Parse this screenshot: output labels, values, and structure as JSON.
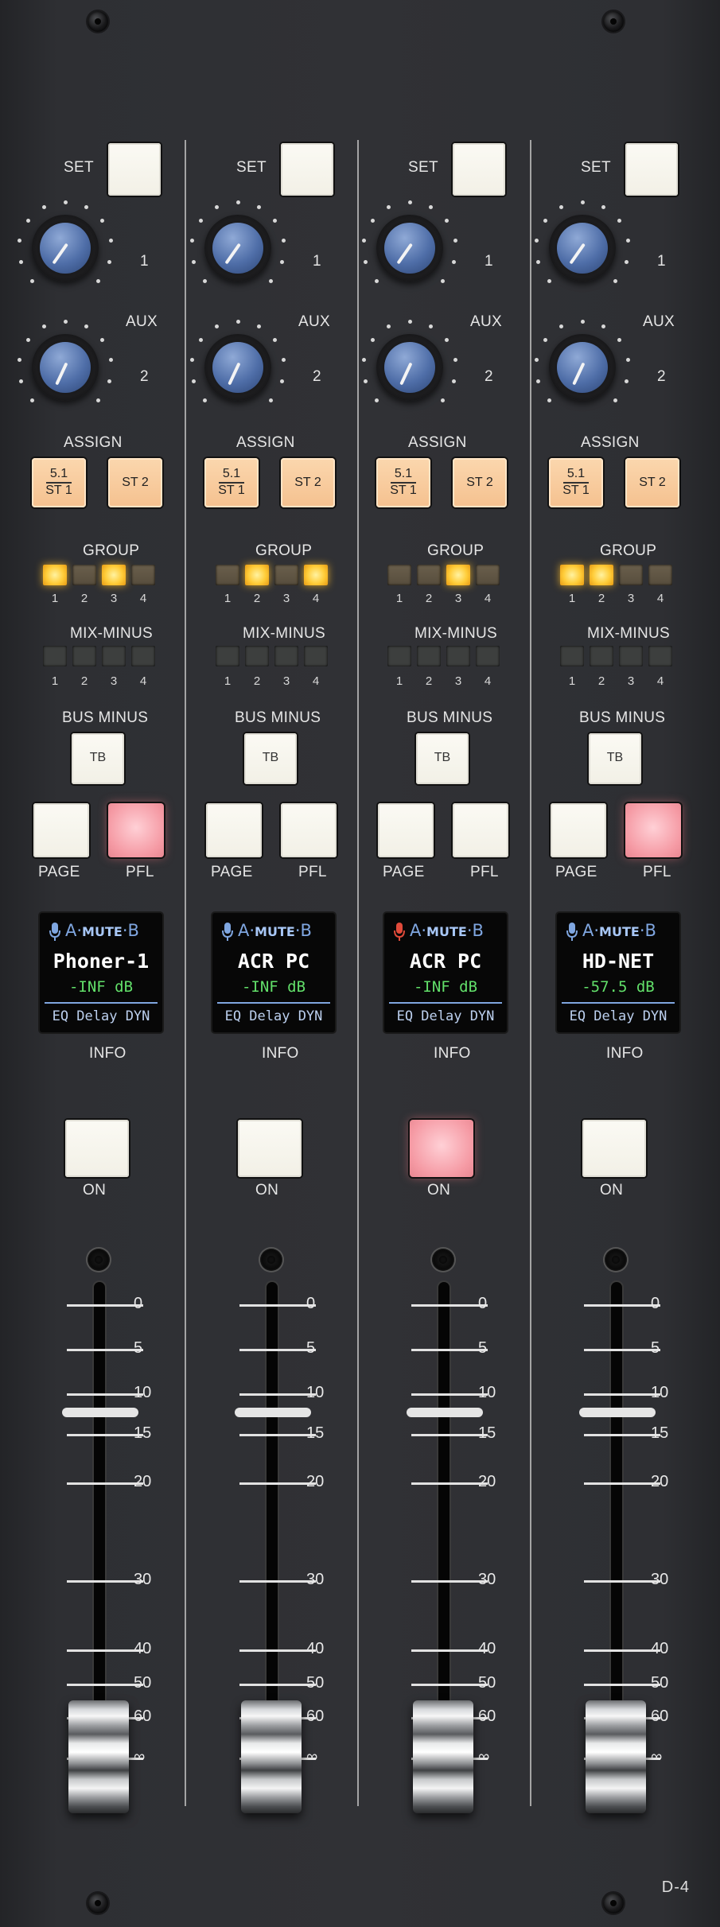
{
  "model": "D-4",
  "channels": [
    {
      "set_label": "SET",
      "aux_label": "AUX",
      "aux1": "1",
      "aux2": "2",
      "assign_label": "ASSIGN",
      "assign_a_top": "5.1",
      "assign_a_bottom": "ST 1",
      "assign_b": "ST 2",
      "group_label": "GROUP",
      "group_leds": [
        "on",
        "dim",
        "on",
        "dim"
      ],
      "mixminus_label": "MIX-MINUS",
      "bus_minus_label": "BUS MINUS",
      "tb_label": "TB",
      "page_label": "PAGE",
      "pfl_label": "PFL",
      "pfl_lit": true,
      "display": {
        "mute_a": "A·",
        "mute": "MUTE",
        "mute_b": "·B",
        "mic_color": "#7fa6e0",
        "name": "Phoner-1",
        "level": "-INF dB",
        "fx": "EQ Delay DYN"
      },
      "info_label": "INFO",
      "on_label": "ON",
      "on_lit": false
    },
    {
      "set_label": "SET",
      "aux_label": "AUX",
      "aux1": "1",
      "aux2": "2",
      "assign_label": "ASSIGN",
      "assign_a_top": "5.1",
      "assign_a_bottom": "ST 1",
      "assign_b": "ST 2",
      "group_label": "GROUP",
      "group_leds": [
        "dim",
        "on",
        "dim",
        "on"
      ],
      "mixminus_label": "MIX-MINUS",
      "bus_minus_label": "BUS MINUS",
      "tb_label": "TB",
      "page_label": "PAGE",
      "pfl_label": "PFL",
      "pfl_lit": false,
      "display": {
        "mute_a": "A·",
        "mute": "MUTE",
        "mute_b": "·B",
        "mic_color": "#7fa6e0",
        "name": "ACR PC",
        "level": "-INF dB",
        "fx": "EQ Delay DYN"
      },
      "info_label": "INFO",
      "on_label": "ON",
      "on_lit": false
    },
    {
      "set_label": "SET",
      "aux_label": "AUX",
      "aux1": "1",
      "aux2": "2",
      "assign_label": "ASSIGN",
      "assign_a_top": "5.1",
      "assign_a_bottom": "ST 1",
      "assign_b": "ST 2",
      "group_label": "GROUP",
      "group_leds": [
        "dim",
        "dim",
        "on",
        "dim"
      ],
      "mixminus_label": "MIX-MINUS",
      "bus_minus_label": "BUS MINUS",
      "tb_label": "TB",
      "page_label": "PAGE",
      "pfl_label": "PFL",
      "pfl_lit": false,
      "display": {
        "mute_a": "A·",
        "mute": "MUTE",
        "mute_b": "·B",
        "mic_color": "#e04a3a",
        "name": "ACR PC",
        "level": "-INF dB",
        "fx": "EQ Delay DYN"
      },
      "info_label": "INFO",
      "on_label": "ON",
      "on_lit": true
    },
    {
      "set_label": "SET",
      "aux_label": "AUX",
      "aux1": "1",
      "aux2": "2",
      "assign_label": "ASSIGN",
      "assign_a_top": "5.1",
      "assign_a_bottom": "ST 1",
      "assign_b": "ST 2",
      "group_label": "GROUP",
      "group_leds": [
        "on",
        "on",
        "dim",
        "dim"
      ],
      "mixminus_label": "MIX-MINUS",
      "bus_minus_label": "BUS MINUS",
      "tb_label": "TB",
      "page_label": "PAGE",
      "pfl_label": "PFL",
      "pfl_lit": true,
      "display": {
        "mute_a": "A·",
        "mute": "MUTE",
        "mute_b": "·B",
        "mic_color": "#7fa6e0",
        "name": "HD-NET",
        "level": "-57.5 dB",
        "fx": "EQ Delay DYN"
      },
      "info_label": "INFO",
      "on_label": "ON",
      "on_lit": false
    }
  ],
  "led_numbers": [
    "1",
    "2",
    "3",
    "4"
  ],
  "fader_scale": [
    "0",
    "5",
    "10",
    "15",
    "20",
    "30",
    "40",
    "50",
    "60",
    "∞"
  ]
}
